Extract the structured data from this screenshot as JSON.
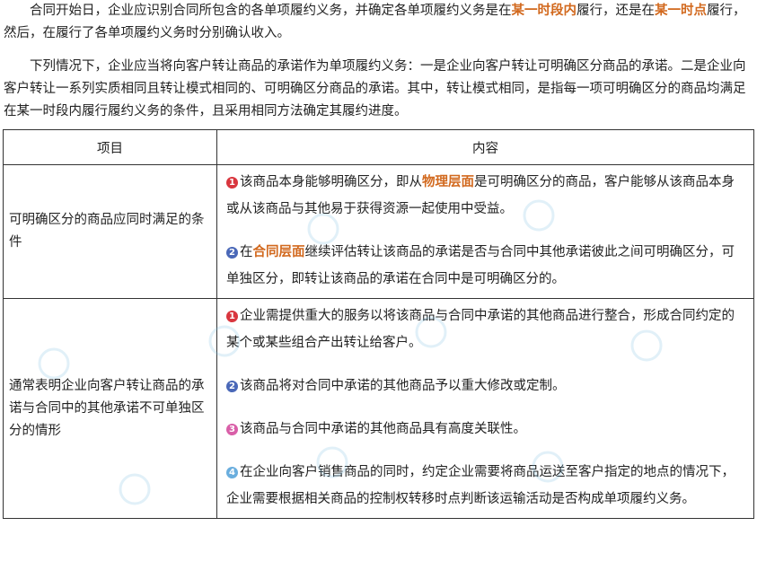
{
  "para1": {
    "t1": "合同开始日，企业应识别合同所包含的各单项履约义务，并确定各单项履约义务是在",
    "h1": "某一时段内",
    "t2": "履行，还是在",
    "h2": "某一时点",
    "t3": "履行，然后，在履行了各单项履约义务时分别确认收入。"
  },
  "para2": "下列情况下，企业应当将向客户转让商品的承诺作为单项履约义务：一是企业向客户转让可明确区分商品的承诺。二是企业向客户转让一系列实质相同且转让模式相同的、可明确区分商品的承诺。其中，转让模式相同，是指每一项可明确区分的商品均满足在某一时段内履行履约义务的条件，且采用相同方法确定其履约进度。",
  "table": {
    "header_col1": "项目",
    "header_col2": "内容",
    "row1": {
      "label": "可明确区分的商品应同时满足的条件",
      "items": [
        {
          "num": "1",
          "color": "#d9363e",
          "t1": "该商品本身能够明确区分，即从",
          "h": "物理层面",
          "t2": "是可明确区分的商品，客户能够从该商品本身或从该商品与其他易于获得资源一起使用中受益。"
        },
        {
          "num": "2",
          "color": "#4a68b8",
          "t1": "在",
          "h": "合同层面",
          "t2": "继续评估转让该商品的承诺是否与合同中其他承诺彼此之间可明确区分，可单独区分，即转让该商品的承诺在合同中是可明确区分的。"
        }
      ]
    },
    "row2": {
      "label": "通常表明企业向客户转让商品的承诺与合同中的其他承诺不可单独区分的情形",
      "items": [
        {
          "num": "1",
          "color": "#d9363e",
          "text": "企业需提供重大的服务以将该商品与合同中承诺的其他商品进行整合，形成合同约定的某个或某些组合产出转让给客户。"
        },
        {
          "num": "2",
          "color": "#4a68b8",
          "text": "该商品将对合同中承诺的其他商品予以重大修改或定制。"
        },
        {
          "num": "3",
          "color": "#d95fa8",
          "text": "该商品与合同中承诺的其他商品具有高度关联性。"
        },
        {
          "num": "4",
          "color": "#6aaede",
          "text": "在企业向客户销售商品的同时，约定企业需要将商品运送至客户指定的地点的情况下，企业需要根据相关商品的控制权转移时点判断该运输活动是否构成单项履约义务。"
        }
      ]
    }
  }
}
